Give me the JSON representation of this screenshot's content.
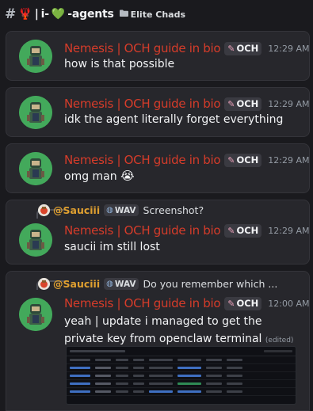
{
  "header": {
    "hash": "#",
    "emoji": "🦞",
    "separator": "|",
    "channel_prefix": "i-",
    "channel_heart": "💚",
    "channel_suffix": "-agents",
    "breadcrumb_icon": "folder-icon",
    "breadcrumb": "Elite Chads"
  },
  "user": {
    "name": "Nemesis | OCH guide in bio",
    "tag": "OCH",
    "tag_icon": "syringe-icon",
    "name_color": "#d63c2a"
  },
  "messages": [
    {
      "time": "12:29 AM",
      "text": "how is that possible"
    },
    {
      "time": "12:29 AM",
      "text": "idk the agent literally forget everything"
    },
    {
      "time": "12:29 AM",
      "text": "omg man",
      "emoji": "😭"
    },
    {
      "time": "12:29 AM",
      "text": "saucii im still lost",
      "reply": {
        "name": "@Sauciii",
        "tag": "WAV",
        "text": "Screenshot?"
      }
    },
    {
      "time": "12:00 AM",
      "text": "yeah | update i managed to get the private key from openclaw terminal",
      "edited": "(edited)",
      "reply": {
        "name": "@Sauciii",
        "tag": "WAV",
        "text": "Do you remember which ..."
      }
    }
  ],
  "attachment": {
    "type": "screenshot-image",
    "icon": "image-icon"
  }
}
